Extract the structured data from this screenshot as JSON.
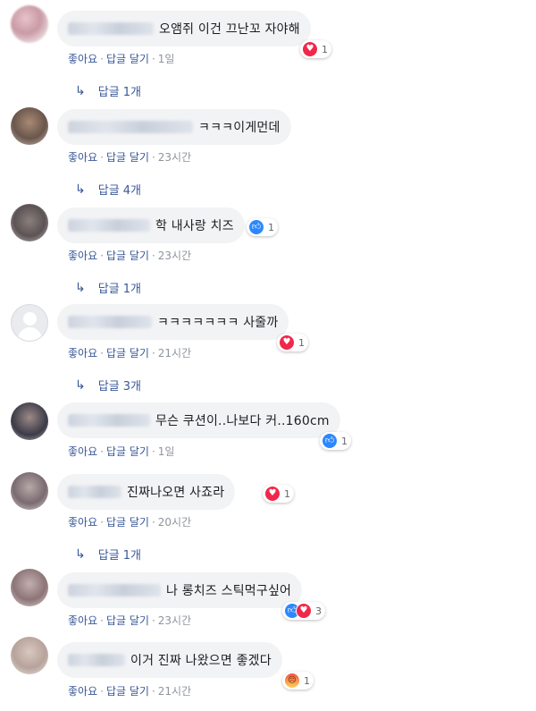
{
  "action_labels": {
    "like": "좋아요",
    "reply": "답글 달기",
    "separator": "·"
  },
  "comments": [
    {
      "text": "오앰쥐 이건 끄난꼬 자야해",
      "time": "1일",
      "reaction_count": "1",
      "replies": "답글 1개"
    },
    {
      "text": "ㅋㅋㅋ이게먼데",
      "time": "23시간",
      "replies": "답글 4개"
    },
    {
      "text": "학 내사랑 치즈",
      "time": "23시간",
      "reaction_count": "1",
      "replies": "답글 1개"
    },
    {
      "text": "ㅋㅋㅋㅋㅋㅋㅋ 사줄까",
      "time": "21시간",
      "reaction_count": "1",
      "replies": "답글 3개"
    },
    {
      "text": "무슨 쿠션이..나보다 커..160cm",
      "time": "1일",
      "reaction_count": "1"
    },
    {
      "text": "진짜나오면 사죠라",
      "time": "20시간",
      "reaction_count": "1",
      "replies": "답글 1개"
    },
    {
      "text": "나 롱치즈 스틱먹구싶어",
      "time": "23시간",
      "reaction_count": "3"
    },
    {
      "text": "이거 진짜 나왔으면 좋겠다",
      "time": "21시간",
      "reaction_count": "1"
    }
  ],
  "reaction_icons": [
    "heart-icon",
    "thumbs-up-icon",
    "angry-face-icon"
  ],
  "colors": {
    "bubble": "#f2f3f5",
    "link": "#385898",
    "meta": "#90949c",
    "love": "#f0284a",
    "like": "#2d88ff"
  }
}
